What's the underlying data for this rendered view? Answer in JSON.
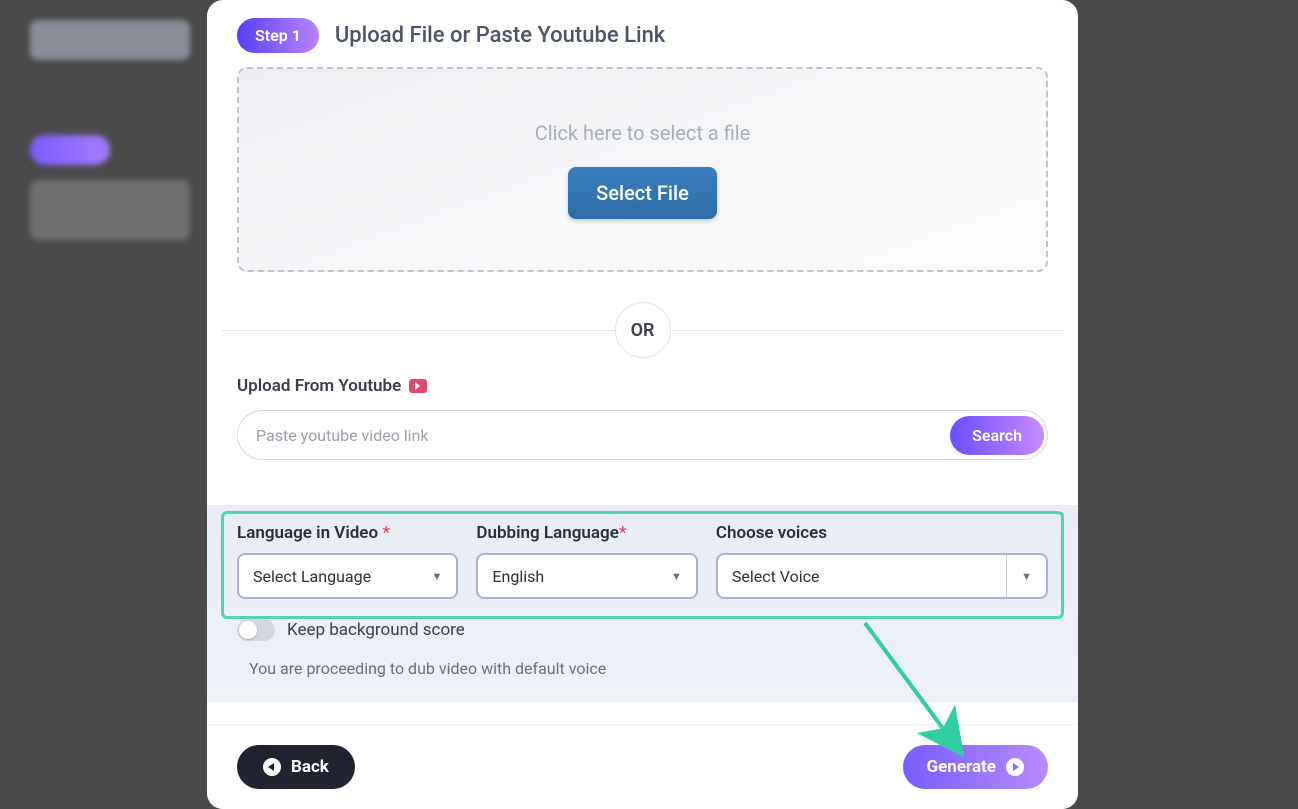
{
  "step": {
    "badge": "Step 1",
    "title": "Upload File or Paste Youtube Link"
  },
  "dropzone": {
    "hint": "Click here to select a file",
    "button": "Select File"
  },
  "divider": "OR",
  "youtube": {
    "label": "Upload From Youtube",
    "placeholder": "Paste youtube video link",
    "search_button": "Search"
  },
  "fields": {
    "language_in_video": {
      "label": "Language in Video",
      "required": "*",
      "value": "Select Language"
    },
    "dubbing_language": {
      "label": "Dubbing Language",
      "required": "*",
      "value": "English"
    },
    "choose_voices": {
      "label": "Choose voices",
      "value": "Select Voice"
    }
  },
  "toggle": {
    "label": "Keep background score",
    "on": false
  },
  "info": "You are proceeding to dub video with default voice",
  "footer": {
    "back": "Back",
    "generate": "Generate"
  },
  "colors": {
    "highlight": "#4fd6b0",
    "gradient_start": "#6a4cff",
    "gradient_end": "#c98bff"
  }
}
